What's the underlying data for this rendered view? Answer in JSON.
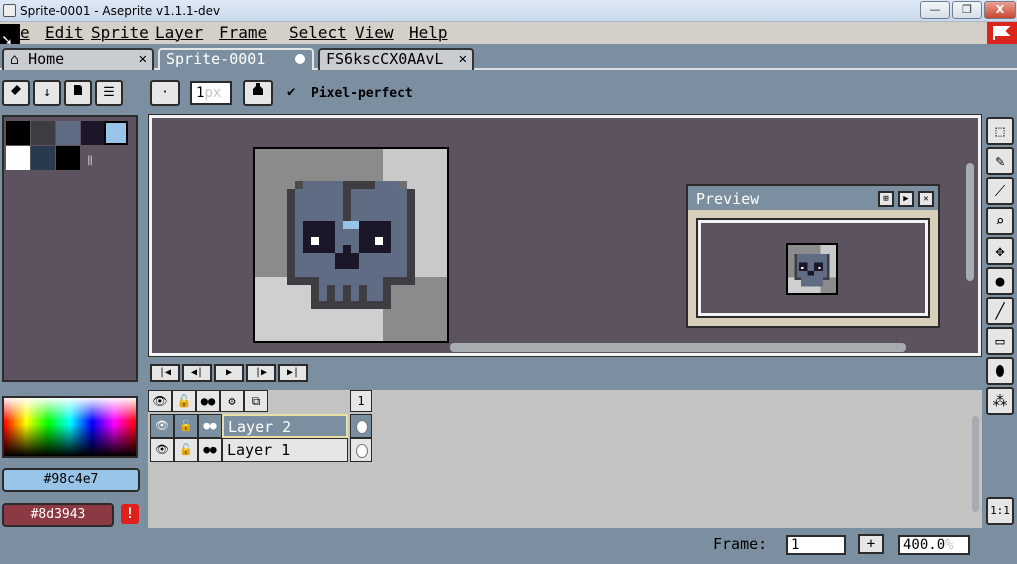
{
  "window": {
    "title": "Sprite-0001 - Aseprite v1.1.1-dev",
    "minimize": "—",
    "maximize": "❐",
    "close": "X"
  },
  "menu": {
    "items": [
      "File",
      "Edit",
      "Sprite",
      "Layer",
      "Frame",
      "Select",
      "View",
      "Help"
    ],
    "file_visible": "e"
  },
  "tabs": [
    {
      "label": "Home",
      "icon": "home-icon",
      "close": "✕"
    },
    {
      "label": "Sprite-0001",
      "active": true
    },
    {
      "label": "FS6kscCX0AAvL",
      "close": "✕"
    }
  ],
  "toolbar": {
    "brush_size_value": "1",
    "brush_size_unit": "px",
    "pixel_perfect_checked": true,
    "pixel_perfect_label": "Pixel-perfect"
  },
  "palette": {
    "colors": [
      "#000000",
      "#3d3d42",
      "#5f6c83",
      "#1b1628",
      "#98c4e7",
      "#ffffff",
      "#2a3a4e",
      "#000000"
    ],
    "selected_index": 4
  },
  "colors": {
    "foreground": "#98c4e7",
    "background": "#8d3943",
    "foreground_label": "#98c4e7",
    "background_label": "#8d3943"
  },
  "preview": {
    "title": "Preview"
  },
  "timeline": {
    "frame_number": "1",
    "layers": [
      {
        "name": "Layer 2",
        "selected": true
      },
      {
        "name": "Layer 1",
        "selected": false
      }
    ]
  },
  "status": {
    "frame_label": "Frame:",
    "frame_value": "1",
    "frame_add": "+",
    "zoom_value": "400.0",
    "zoom_unit": "%",
    "one_to_one": "1:1"
  }
}
